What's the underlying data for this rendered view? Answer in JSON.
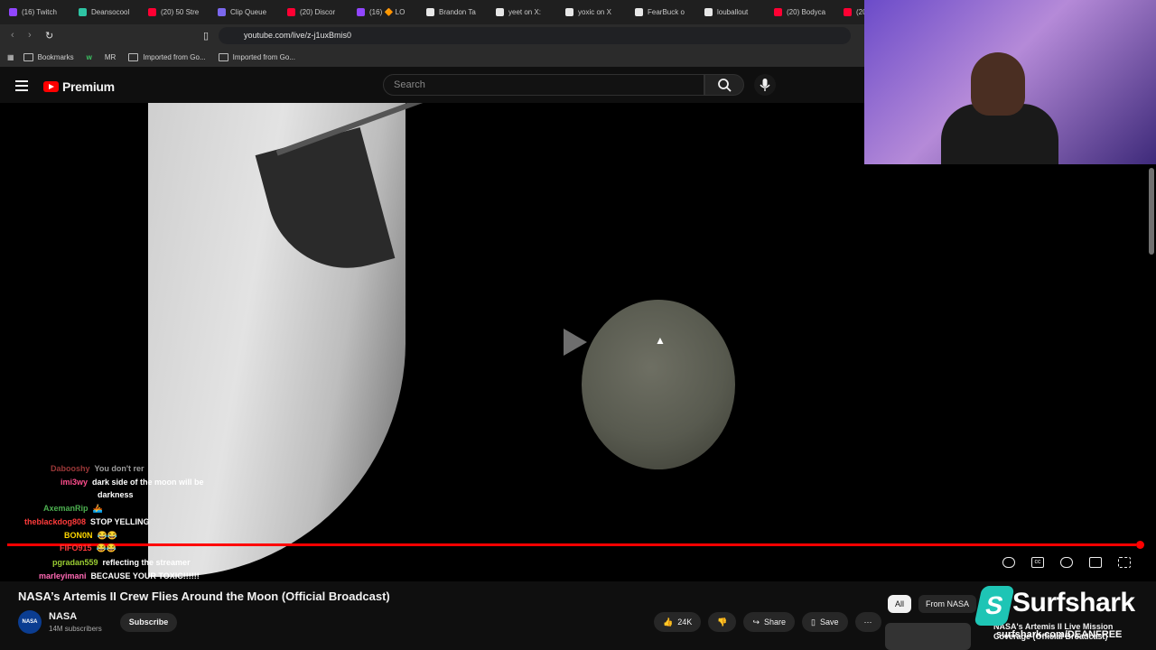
{
  "browser": {
    "tabs": [
      {
        "label": "(16) Twitch",
        "color": "#9146ff"
      },
      {
        "label": "Deansocool",
        "color": "#2ec4a3"
      },
      {
        "label": "(20) 50 Stre",
        "color": "#ff0033"
      },
      {
        "label": "Clip Queue",
        "color": "#7b68ee"
      },
      {
        "label": "(20) Discor",
        "color": "#ff0033"
      },
      {
        "label": "(16) 🔶 LO",
        "color": "#9146ff"
      },
      {
        "label": "Brandon Ta",
        "color": "#e7e7e7"
      },
      {
        "label": "yeet on X:",
        "color": "#e7e7e7"
      },
      {
        "label": "yoxic on X",
        "color": "#e7e7e7"
      },
      {
        "label": "FearBuck o",
        "color": "#e7e7e7"
      },
      {
        "label": "louballout",
        "color": "#e7e7e7"
      },
      {
        "label": "(20) Bodyca",
        "color": "#ff0033"
      },
      {
        "label": "(20) H",
        "color": "#ff0033"
      }
    ],
    "url": "youtube.com/live/z-j1uxBmis0",
    "bookmarks": [
      "Bookmarks",
      "w",
      "MR",
      "Imported from Go...",
      "Imported from Go..."
    ]
  },
  "youtube": {
    "brand": "Premium",
    "search_placeholder": "Search"
  },
  "chat": [
    {
      "name": "Dabooshy",
      "text": "You don't rer",
      "color": "#ff5c5c"
    },
    {
      "name": "imi3wy",
      "text": "dark side of the moon will be",
      "color": "#ff4d8d"
    },
    {
      "name": "",
      "text": "darkness",
      "color": "#ffffff"
    },
    {
      "name": "AxemanRip",
      "text": "🚣",
      "color": "#4caf50"
    },
    {
      "name": "theblackdog808",
      "text": "STOP YELLING",
      "color": "#ff3b3b"
    },
    {
      "name": "BON0N",
      "text": "😂😂",
      "color": "#ffd700"
    },
    {
      "name": "FIFO915",
      "text": "😂😂",
      "color": "#ff3b3b"
    },
    {
      "name": "pgradan559",
      "text": "reflecting the streamer",
      "color": "#9acd32"
    },
    {
      "name": "marleyimani",
      "text": "BECAUSE YOUR TOXIC!!!!!!",
      "color": "#ff69b4"
    }
  ],
  "video": {
    "title": "NASA’s Artemis II Crew Flies Around the Moon (Official Broadcast)",
    "progress_pct": 99.5,
    "channel": "NASA",
    "subscribers": "14M subscribers",
    "subscribe_label": "Subscribe",
    "likes": "24K",
    "share_label": "Share",
    "save_label": "Save"
  },
  "sidebar": {
    "chips": [
      "All",
      "From NASA"
    ],
    "rec_title": "NASA's Artemis II Live Mission Coverage (Official Broadcast)"
  },
  "overlay": {
    "brand": "Surfshark",
    "url": "surfshark.com/DEANFREE"
  }
}
